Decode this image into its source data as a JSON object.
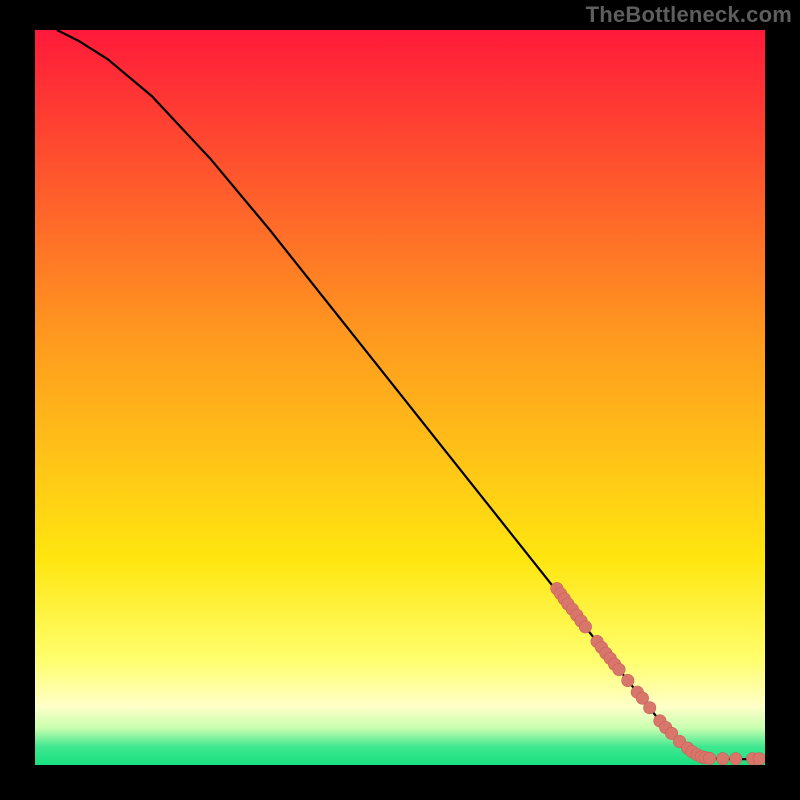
{
  "watermark": "TheBottleneck.com",
  "colors": {
    "frame": "#000000",
    "curve": "#000000",
    "dot_fill": "#d9766c",
    "dot_stroke": "#c95f56",
    "gradient_top": "#ff1a3a",
    "gradient_mid1": "#ff8a1f",
    "gradient_mid2": "#ffe610",
    "gradient_pale": "#ffffb0",
    "gradient_green": "#18e07f"
  },
  "chart_data": {
    "type": "line",
    "title": "",
    "xlabel": "",
    "ylabel": "",
    "xlim": [
      0,
      100
    ],
    "ylim": [
      0,
      100
    ],
    "curve": [
      {
        "x": 3,
        "y": 100
      },
      {
        "x": 6,
        "y": 98.5
      },
      {
        "x": 10,
        "y": 96
      },
      {
        "x": 16,
        "y": 91
      },
      {
        "x": 24,
        "y": 82.5
      },
      {
        "x": 32,
        "y": 73
      },
      {
        "x": 40,
        "y": 63
      },
      {
        "x": 48,
        "y": 53
      },
      {
        "x": 56,
        "y": 43
      },
      {
        "x": 64,
        "y": 33
      },
      {
        "x": 70,
        "y": 25.5
      },
      {
        "x": 76,
        "y": 18
      },
      {
        "x": 82,
        "y": 10.5
      },
      {
        "x": 86,
        "y": 5.5
      },
      {
        "x": 89,
        "y": 2.5
      },
      {
        "x": 91,
        "y": 1.2
      },
      {
        "x": 94,
        "y": 0.8
      },
      {
        "x": 100,
        "y": 0.8
      }
    ],
    "dots": [
      {
        "x": 71.5,
        "y": 24.0
      },
      {
        "x": 72.0,
        "y": 23.3
      },
      {
        "x": 72.5,
        "y": 22.6
      },
      {
        "x": 73.0,
        "y": 21.9
      },
      {
        "x": 73.6,
        "y": 21.2
      },
      {
        "x": 74.2,
        "y": 20.4
      },
      {
        "x": 74.8,
        "y": 19.6
      },
      {
        "x": 75.4,
        "y": 18.8
      },
      {
        "x": 77.0,
        "y": 16.8
      },
      {
        "x": 77.6,
        "y": 16.0
      },
      {
        "x": 78.2,
        "y": 15.2
      },
      {
        "x": 78.8,
        "y": 14.5
      },
      {
        "x": 79.4,
        "y": 13.7
      },
      {
        "x": 80.0,
        "y": 13.0
      },
      {
        "x": 81.2,
        "y": 11.5
      },
      {
        "x": 82.5,
        "y": 9.9
      },
      {
        "x": 83.2,
        "y": 9.1
      },
      {
        "x": 84.2,
        "y": 7.8
      },
      {
        "x": 85.6,
        "y": 6.0
      },
      {
        "x": 86.4,
        "y": 5.1
      },
      {
        "x": 87.2,
        "y": 4.3
      },
      {
        "x": 88.3,
        "y": 3.2
      },
      {
        "x": 89.4,
        "y": 2.3
      },
      {
        "x": 90.0,
        "y": 1.8
      },
      {
        "x": 90.7,
        "y": 1.4
      },
      {
        "x": 91.3,
        "y": 1.1
      },
      {
        "x": 91.8,
        "y": 1.0
      },
      {
        "x": 92.4,
        "y": 0.9
      },
      {
        "x": 94.2,
        "y": 0.85
      },
      {
        "x": 96.0,
        "y": 0.85
      },
      {
        "x": 98.3,
        "y": 0.85
      },
      {
        "x": 99.2,
        "y": 0.85
      }
    ]
  }
}
